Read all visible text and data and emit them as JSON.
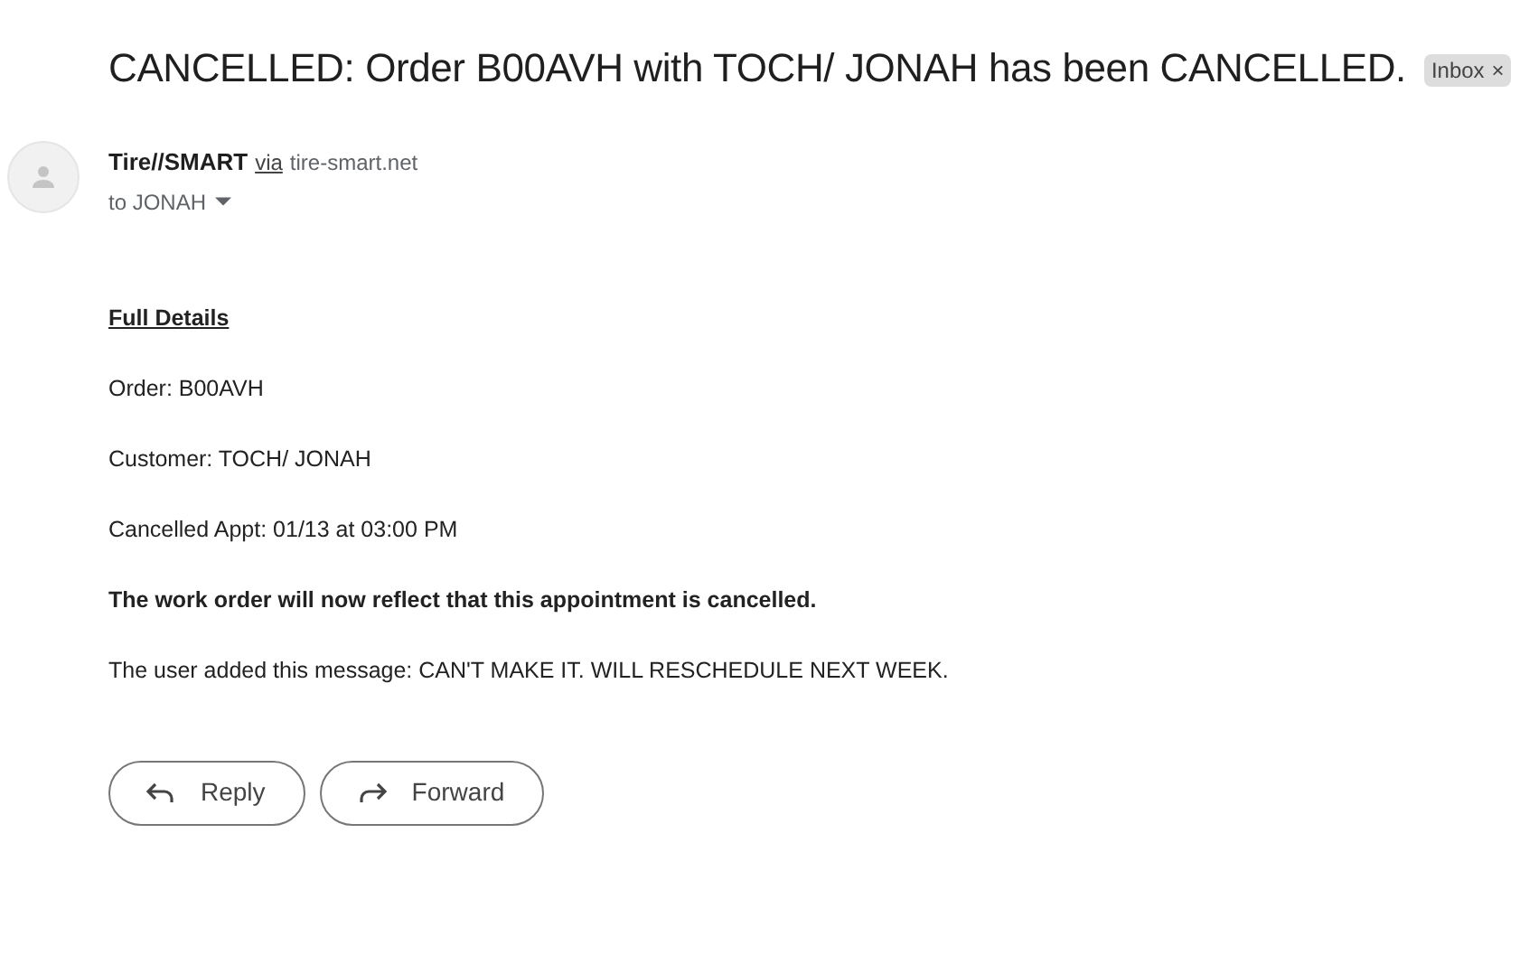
{
  "subject": "CANCELLED: Order B00AVH with TOCH/ JONAH has been CANCELLED.",
  "label": {
    "text": "Inbox",
    "close": "×"
  },
  "sender": {
    "name": "Tire//SMART",
    "via": "via",
    "domain": "tire-smart.net",
    "to": "to JONAH"
  },
  "body": [
    {
      "kind": "heading",
      "text": "Full Details"
    },
    {
      "kind": "text",
      "text": "Order: B00AVH"
    },
    {
      "kind": "text",
      "text": "Customer: TOCH/ JONAH"
    },
    {
      "kind": "text",
      "text": "Cancelled Appt: 01/13 at 03:00 PM"
    },
    {
      "kind": "bold",
      "text": "The work order will now reflect that this appointment is cancelled."
    },
    {
      "kind": "text",
      "text": "The user added this message: CAN'T MAKE IT. WILL RESCHEDULE NEXT WEEK."
    }
  ],
  "actions": [
    {
      "kind": "reply",
      "label": "Reply"
    },
    {
      "kind": "forward",
      "label": "Forward"
    }
  ]
}
